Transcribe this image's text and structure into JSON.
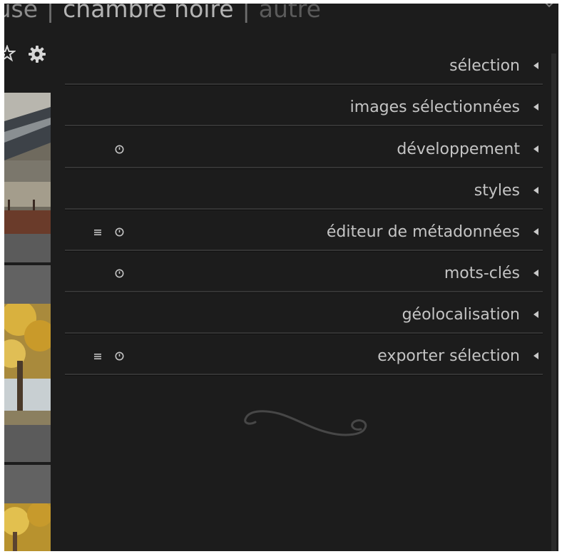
{
  "header": {
    "view_left": "lumineuse",
    "separator": "|",
    "view_active": "chambre noire",
    "view_right": "autre"
  },
  "modules": [
    {
      "label": "sélection",
      "presets": false,
      "reset": false
    },
    {
      "label": "images sélectionnées",
      "presets": false,
      "reset": false
    },
    {
      "label": "développement",
      "presets": false,
      "reset": true
    },
    {
      "label": "styles",
      "presets": false,
      "reset": false
    },
    {
      "label": "éditeur de métadonnées",
      "presets": true,
      "reset": true
    },
    {
      "label": "mots-clés",
      "presets": false,
      "reset": true
    },
    {
      "label": "géolocalisation",
      "presets": false,
      "reset": false
    },
    {
      "label": "exporter sélection",
      "presets": true,
      "reset": true
    }
  ],
  "icons": {
    "star": "star-icon",
    "gear": "gear-icon",
    "expand": "triangle-left-icon",
    "presets": "hamburger-icon",
    "reset": "reset-icon",
    "ornament": "flourish-icon"
  },
  "colors": {
    "background": "#1c1c1c",
    "text": "#c4c4c4",
    "separator": "#343434",
    "header_text": "#8c8c8c"
  }
}
